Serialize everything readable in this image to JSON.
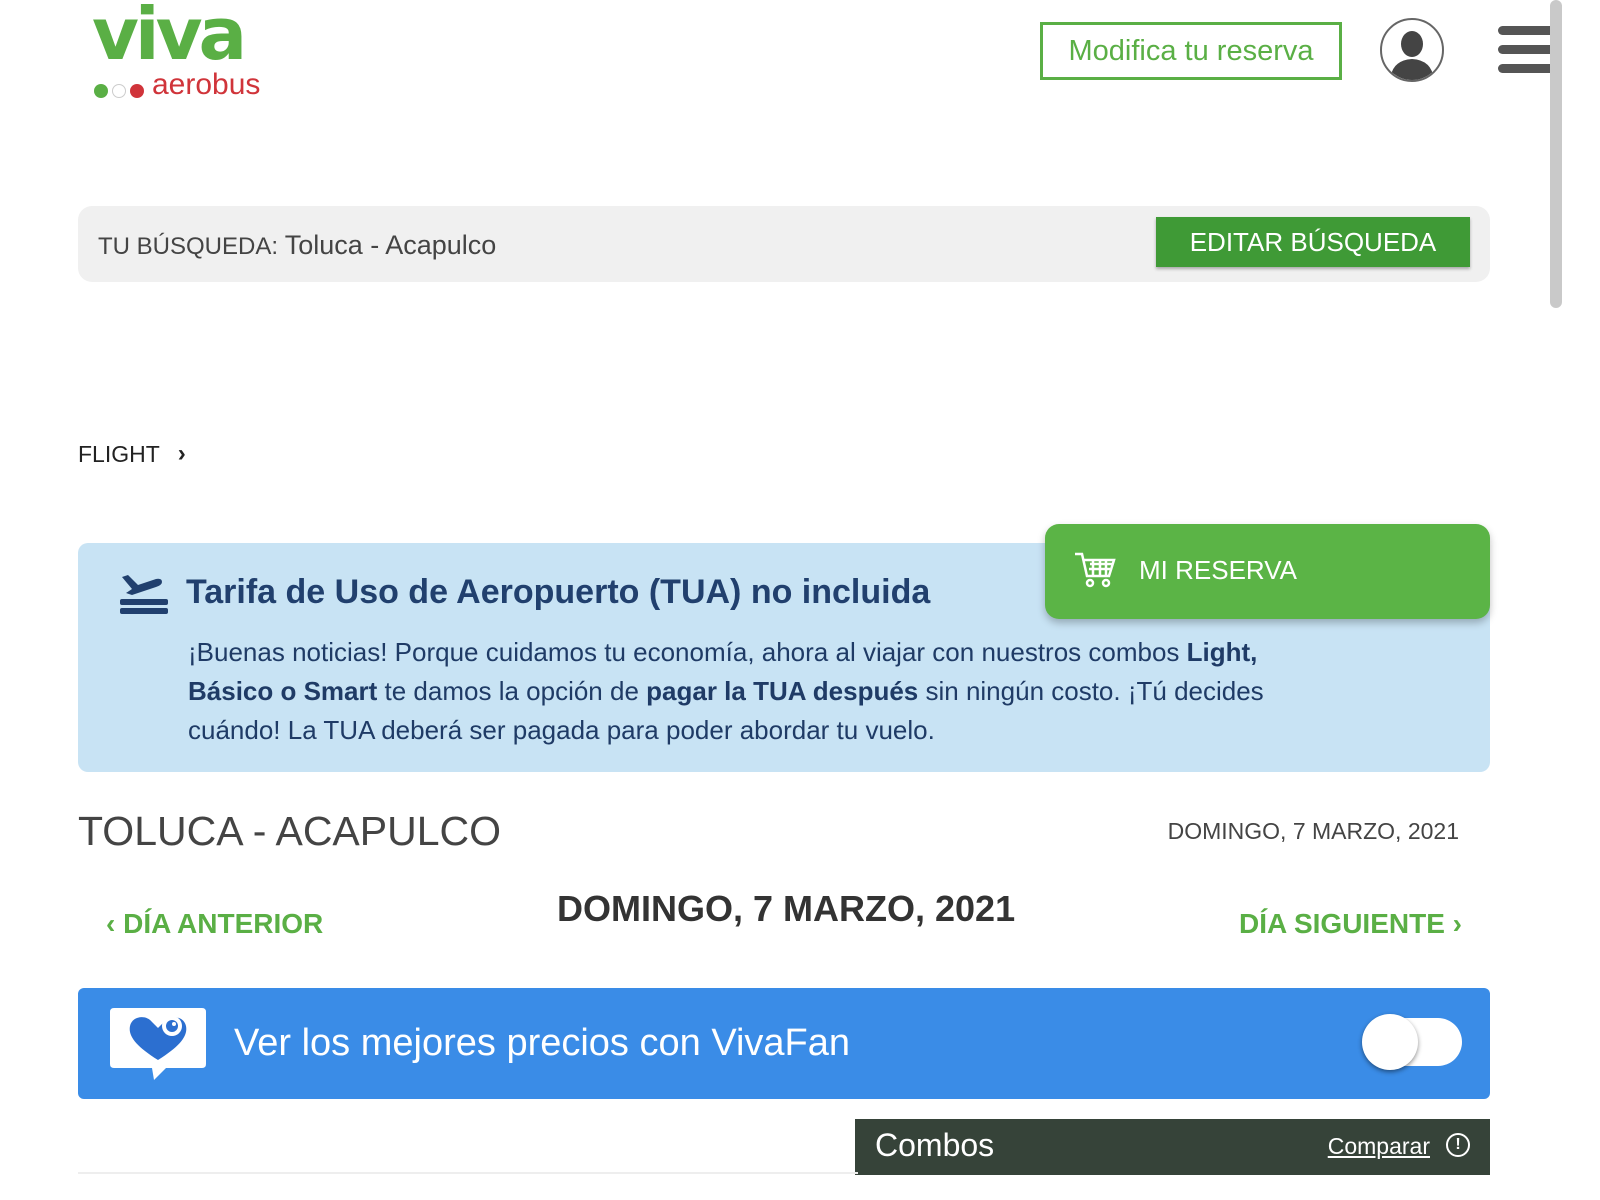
{
  "header": {
    "logo_main": "viva",
    "logo_sub": "aerobus",
    "modify_label": "Modifica tu reserva",
    "avatar_icon": "user-avatar-icon",
    "menu_icon": "hamburger-menu-icon"
  },
  "search": {
    "label": "TU BÚSQUEDA:",
    "value": "Toluca - Acapulco",
    "edit_label": "EDITAR BÚSQUEDA"
  },
  "breadcrumb": {
    "item": "FLIGHT",
    "separator": "›"
  },
  "tua": {
    "icon": "airplane-landing-icon",
    "title": "Tarifa de Uso de Aeropuerto (TUA) no incluida",
    "text_1": "¡Buenas noticias! Porque cuidamos tu economía, ahora al viajar con nuestros combos ",
    "bold_1": "Light, Básico o Smart",
    "text_2": " te damos la opción de ",
    "bold_2": "pagar la TUA después",
    "text_3": " sin ningún costo. ¡Tú decides cuándo! La TUA deberá ser pagada para poder abordar tu vuelo."
  },
  "reserva": {
    "icon": "shopping-cart-icon",
    "label": "MI RESERVA"
  },
  "route": {
    "title": "TOLUCA - ACAPULCO",
    "date": "DOMINGO, 7 MARZO, 2021"
  },
  "day_nav": {
    "prev": "‹ DÍA ANTERIOR",
    "current": "DOMINGO, 7 MARZO, 2021",
    "next": "DÍA SIGUIENTE ›"
  },
  "vivafan": {
    "icon": "heart-chat-icon",
    "label": "Ver los mejores precios con VivaFan",
    "toggle_on": false
  },
  "combos": {
    "title": "Combos",
    "compare_label": "Comparar",
    "info_icon": "!"
  },
  "colors": {
    "brand_green": "#5aaf45",
    "button_green": "#3f9a36",
    "brand_red": "#d0343a",
    "info_blue_bg": "#c8e3f4",
    "vivafan_blue": "#3a8ce7",
    "combos_bg": "#364339"
  }
}
